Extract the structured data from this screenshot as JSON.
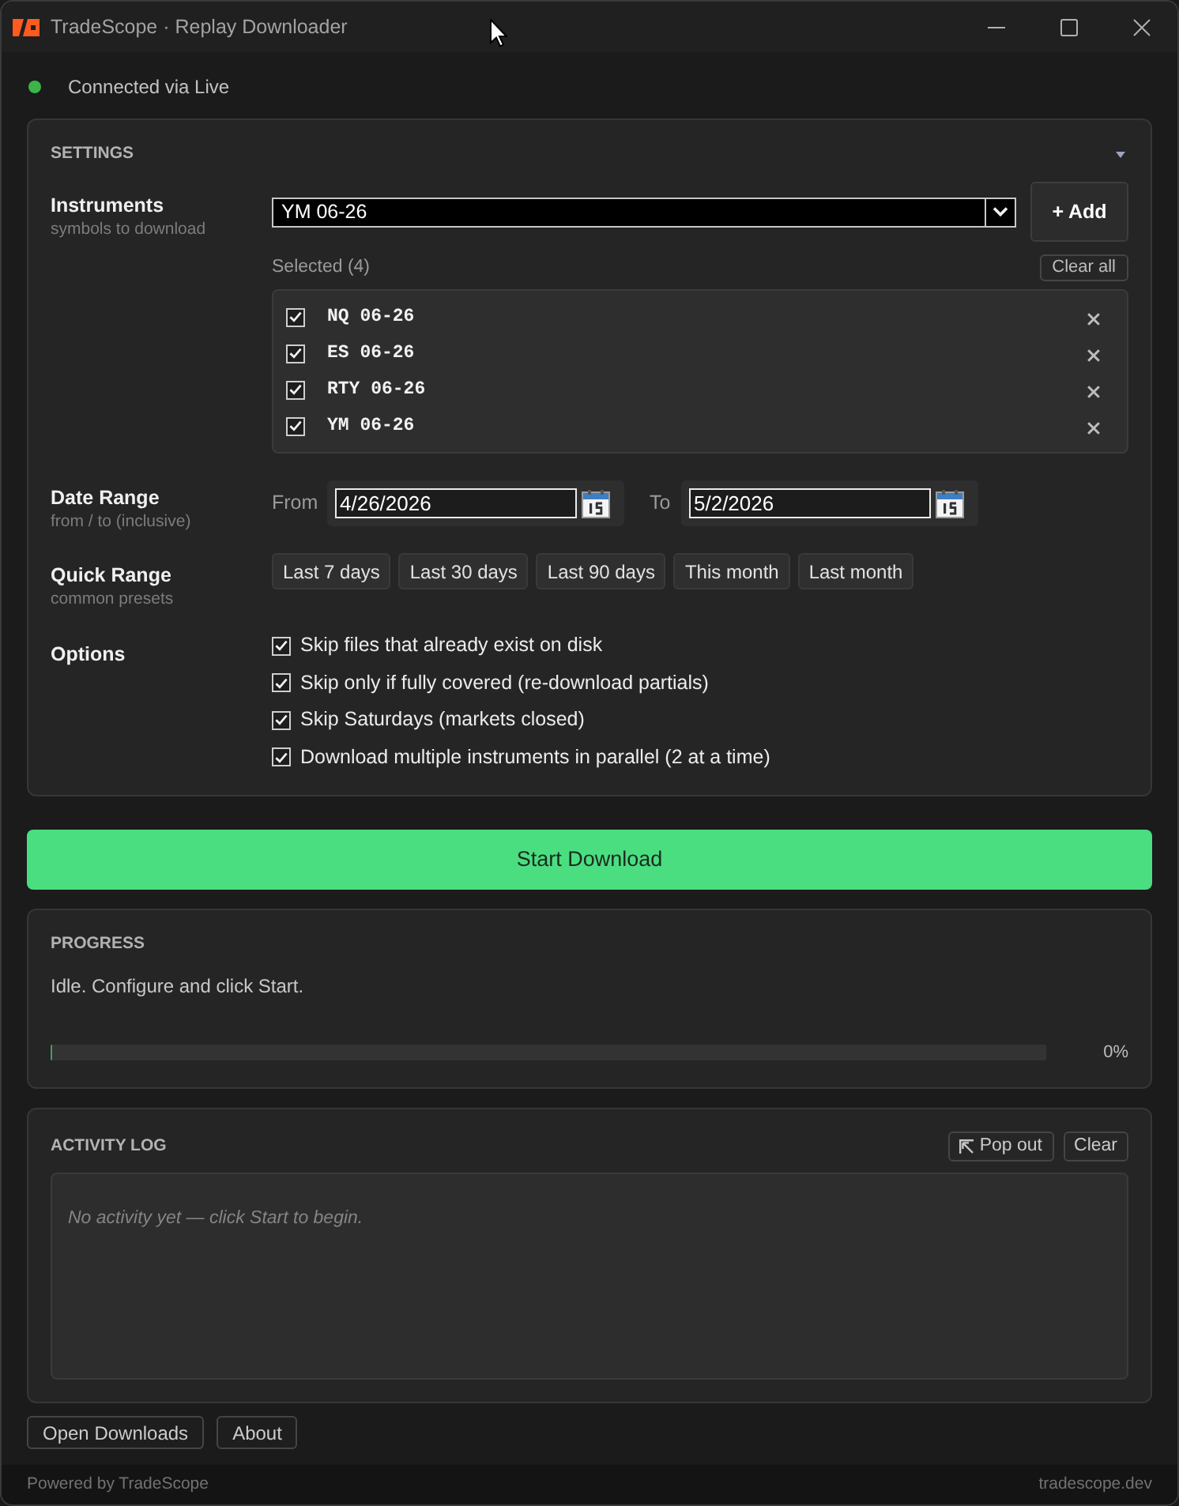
{
  "window": {
    "title": "TradeScope · Replay Downloader"
  },
  "connection": {
    "label": "Connected via Live",
    "connected": true
  },
  "settings": {
    "title": "SETTINGS",
    "expanded": true,
    "instruments": {
      "label": "Instruments",
      "hint": "symbols to download",
      "dropdown_value": "YM 06-26",
      "add_button": "+ Add",
      "selected_label": "Selected (4)",
      "clear_button": "Clear all",
      "items": [
        {
          "symbol": "NQ 06-26",
          "checked": true
        },
        {
          "symbol": "ES 06-26",
          "checked": true
        },
        {
          "symbol": "RTY 06-26",
          "checked": true
        },
        {
          "symbol": "YM 06-26",
          "checked": true
        }
      ]
    },
    "date_range": {
      "label": "Date Range",
      "hint": "from / to (inclusive)",
      "from_label": "From",
      "from_value": "4/26/2026",
      "to_label": "To",
      "to_value": "5/2/2026"
    },
    "quick_range": {
      "label": "Quick Range",
      "hint": "common presets",
      "buttons": [
        "Last 7 days",
        "Last 30 days",
        "Last 90 days",
        "This month",
        "Last month"
      ]
    },
    "options": {
      "label": "Options",
      "items": [
        {
          "label": "Skip files that already exist on disk",
          "checked": true
        },
        {
          "label": "Skip only if fully covered (re-download partials)",
          "checked": true
        },
        {
          "label": "Skip Saturdays (markets closed)",
          "checked": true
        },
        {
          "label": "Download multiple instruments in parallel (2 at a time)",
          "checked": true
        }
      ]
    }
  },
  "start_button": "Start Download",
  "progress": {
    "title": "PROGRESS",
    "status": "Idle. Configure and click Start.",
    "level": 0,
    "reading": "0%"
  },
  "activity_log": {
    "title": "ACTIVITY LOG",
    "buttons": [
      {
        "label": "Pop out",
        "kind": "popout"
      },
      {
        "label": "Clear",
        "kind": "plain"
      }
    ],
    "empty_message": "No activity yet — click Start to begin."
  },
  "footer_buttons": [
    "Open Downloads",
    "About"
  ],
  "status_bar": {
    "left": "Powered by TradeScope",
    "right": "tradescope.dev"
  }
}
